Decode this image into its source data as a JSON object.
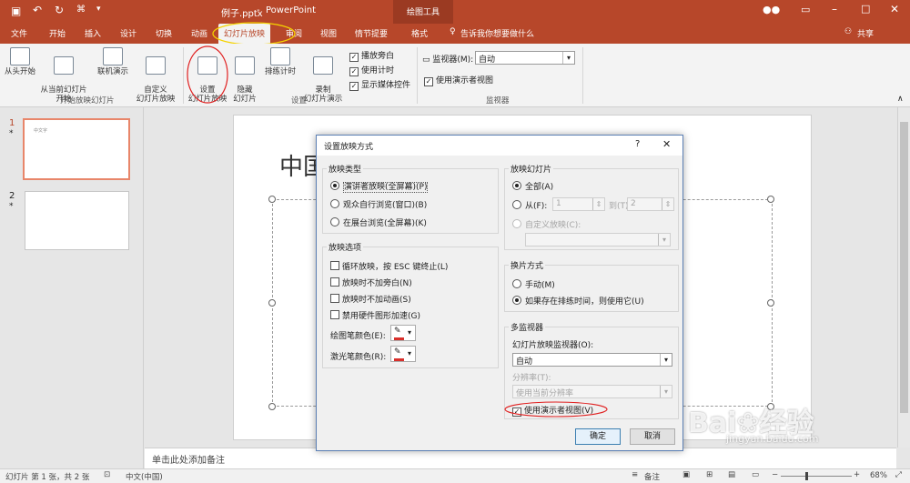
{
  "titlebar": {
    "filename": "例子.pptx",
    "app": "PowerPoint",
    "context_label": "绘图工具",
    "window_controls": [
      "minimize-icon",
      "restore-icon",
      "close-icon"
    ]
  },
  "tabs": [
    "文件",
    "开始",
    "插入",
    "设计",
    "切换",
    "动画",
    "幻灯片放映",
    "审阅",
    "视图",
    "情节提要",
    "格式"
  ],
  "active_tab": "幻灯片放映",
  "tell_me": "告诉我你想要做什么",
  "share": "共享",
  "ribbon": {
    "from_start": "从头开始",
    "from_current": "从当前幻灯片\n开始",
    "online": "联机演示",
    "custom": "自定义\n幻灯片放映",
    "group1_label": "开始放映幻灯片",
    "setup": "设置\n幻灯片放映",
    "hide": "隐藏\n幻灯片",
    "rehearse": "排练计时",
    "record": "录制\n幻灯片演示",
    "play_narration": "播放旁白",
    "use_timings": "使用计时",
    "show_media": "显示媒体控件",
    "group2_label": "设置",
    "monitor_label": "监视器(M):",
    "monitor_value": "自动",
    "presenter_view": "使用演示者视图",
    "group3_label": "监视器"
  },
  "thumbnails": [
    {
      "num": "1",
      "star": "*",
      "text": "中文字"
    },
    {
      "num": "2",
      "star": "*",
      "text": ""
    }
  ],
  "slide_title_partial": "中国",
  "notes_placeholder": "单击此处添加备注",
  "status": {
    "slide": "幻灯片 第 1 张，共 2 张",
    "language": "中文(中国)",
    "notes": "备注",
    "zoom": "68%"
  },
  "dialog": {
    "title": "设置放映方式",
    "help": "?",
    "show_type": {
      "label": "放映类型",
      "options": [
        "演讲者放映(全屏幕)(P)",
        "观众自行浏览(窗口)(B)",
        "在展台浏览(全屏幕)(K)"
      ],
      "selected": 0
    },
    "show_options": {
      "label": "放映选项",
      "items": [
        "循环放映，按 ESC 键终止(L)",
        "放映时不加旁白(N)",
        "放映时不加动画(S)",
        "禁用硬件图形加速(G)"
      ],
      "pen_color": "绘图笔颜色(E):",
      "laser_color": "激光笔颜色(R):"
    },
    "show_slides": {
      "label": "放映幻灯片",
      "all": "全部(A)",
      "from": "从(F):",
      "from_value": "1",
      "to": "到(T):",
      "to_value": "2",
      "custom": "自定义放映(C):"
    },
    "advance": {
      "label": "换片方式",
      "manual": "手动(M)",
      "timings": "如果存在排练时间，则使用它(U)"
    },
    "monitors": {
      "label": "多监视器",
      "monitor_label": "幻灯片放映监视器(O):",
      "monitor_value": "自动",
      "resolution_label": "分辨率(T):",
      "resolution_value": "使用当前分辨率",
      "presenter_view": "使用演示者视图(V)"
    },
    "ok": "确定",
    "cancel": "取消"
  },
  "watermark": {
    "brand": "Bai",
    "brand2": "经验",
    "url": "jingyan.baidu.com"
  },
  "colors": {
    "accent": "#b7472a",
    "pen": "#d9302c",
    "laser": "#d9302c",
    "annotation": "#e02020",
    "highlight": "#f5d300"
  }
}
